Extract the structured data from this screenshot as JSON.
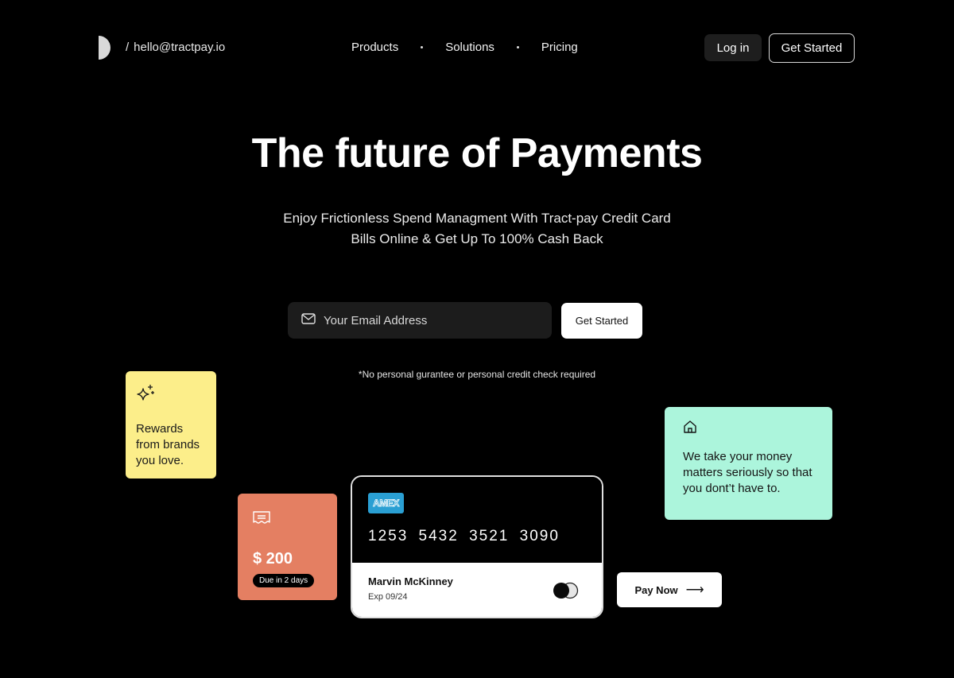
{
  "nav": {
    "slash": "/",
    "email": "hello@tractpay.io",
    "links": [
      "Products",
      "Solutions",
      "Pricing"
    ],
    "login_label": "Log in",
    "get_started_label": "Get Started"
  },
  "hero": {
    "title": "The future of Payments",
    "subtitle_line1": "Enjoy Frictionless Spend Managment With Tract-pay Credit Card",
    "subtitle_line2": "Bills Online & Get Up To 100% Cash Back",
    "email_placeholder": "Your Email Address",
    "email_value": "",
    "cta_label": "Get Started",
    "disclaimer": "*No personal gurantee or personal credit check required"
  },
  "cards": {
    "rewards": {
      "icon": "sparkles-icon",
      "text": "Rewards from brands you love."
    },
    "bill": {
      "icon": "receipt-icon",
      "amount": "$ 200",
      "due": "Due in 2 days"
    },
    "credit_card": {
      "brand": "AMEX",
      "number": "1253 5432 3521 3090",
      "holder": "Marvin McKinney",
      "expiry": "Exp 09/24",
      "brand_color": "#2a9fd3"
    },
    "trust": {
      "icon": "home-icon",
      "text": "We take your money matters seriously so that you dont’t have to."
    },
    "pay_now_label": "Pay Now",
    "pay_now_arrow": "⟶"
  },
  "colors": {
    "background": "#000000",
    "yellow_card": "#fcee8a",
    "orange_card": "#e47f62",
    "mint_card": "#acf5dc"
  }
}
